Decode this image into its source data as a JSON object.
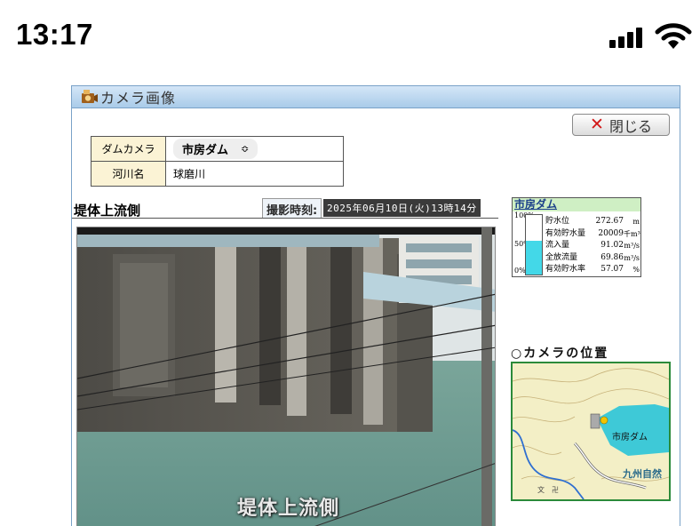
{
  "status_bar": {
    "time": "13:17",
    "signal_icon": "cellular-signal-icon",
    "wifi_icon": "wifi-icon"
  },
  "window": {
    "title": "カメラ画像",
    "title_icon": "camera-icon",
    "close_label": "閉じる",
    "close_icon": "close-icon"
  },
  "info": {
    "camera_label": "ダムカメラ",
    "camera_value": "市房ダム",
    "river_label": "河川名",
    "river_value": "球磨川"
  },
  "image": {
    "section_title": "堤体上流側",
    "shot_label": "撮影時刻:",
    "shot_time": "2025年06月10日(火)13時14分",
    "caption": "堤体上流側"
  },
  "dam_panel": {
    "title": "市房ダム",
    "gauge_ticks": [
      "100%",
      "50%",
      "0%"
    ],
    "fill_percent": 57.07,
    "rows": [
      {
        "label": "貯水位",
        "value": "272.67",
        "unit": "m"
      },
      {
        "label": "有効貯水量",
        "value": "20009",
        "unit": "千m³"
      },
      {
        "label": "流入量",
        "value": "91.02",
        "unit": "m³/s"
      },
      {
        "label": "全放流量",
        "value": "69.86",
        "unit": "m³/s"
      },
      {
        "label": "有効貯水率",
        "value": "57.07",
        "unit": "%"
      }
    ]
  },
  "location": {
    "title": "○カメラの位置",
    "map_dam_label": "市房ダム",
    "map_region_label": "九州自然"
  }
}
